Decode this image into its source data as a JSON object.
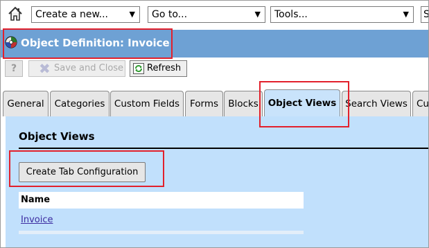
{
  "toolbar": {
    "create_new": "Create a new...",
    "go_to": "Go to...",
    "tools": "Tools...",
    "search_partial": "S"
  },
  "title": "Object Definition: Invoice",
  "actions": {
    "help": "?",
    "save_close": "Save and Close",
    "refresh": "Refresh"
  },
  "tabs": [
    {
      "label": "General"
    },
    {
      "label": "Categories"
    },
    {
      "label": "Custom Fields"
    },
    {
      "label": "Forms"
    },
    {
      "label": "Blocks"
    },
    {
      "label": "Object Views"
    },
    {
      "label": "Search Views"
    },
    {
      "label": "Cu"
    }
  ],
  "active_tab": "Object Views",
  "section": {
    "title": "Object Views",
    "create_button": "Create Tab Configuration",
    "table_header": "Name",
    "rows": [
      {
        "name": "Invoice"
      }
    ]
  },
  "colors": {
    "title_bar": "#6ea1d4",
    "content_bg": "#c1e0fc",
    "highlight": "#e2202b"
  }
}
